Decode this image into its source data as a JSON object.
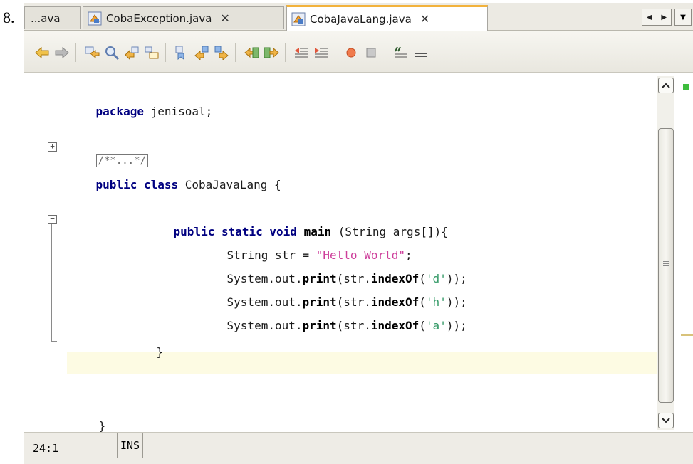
{
  "question_number": "8.",
  "tabs": [
    {
      "label": "...ava",
      "active": false
    },
    {
      "label": "CobaException.java",
      "close": "✕",
      "active": false
    },
    {
      "label": "CobaJavaLang.java",
      "close": "✕",
      "active": true
    }
  ],
  "tab_nav": {
    "left": "◀",
    "right": "▶",
    "dropdown": "▼"
  },
  "toolbar_icons": [
    "back-icon",
    "forward-icon",
    "find-selection-icon",
    "find-previous-icon",
    "find-next-icon",
    "toggle-highlight-icon",
    "toggle-bookmark-icon",
    "previous-bookmark-icon",
    "next-bookmark-icon",
    "shift-left-icon",
    "shift-right-icon",
    "comment-icon",
    "uncomment-icon",
    "start-macro-icon",
    "stop-macro-icon",
    "format-icon",
    "toggle-lines-icon"
  ],
  "code": {
    "package_kw": "package",
    "package_name": " jenisoal;",
    "folded_comment": "/**...*/",
    "class_kw": "public class",
    "class_rest": " CobaJavaLang {",
    "method_kw": "public static void",
    "method_name": "main",
    "method_rest": " (String args[]){",
    "line_str_a": "String str = ",
    "line_str_lit": "\"Hello World\"",
    "line_str_end": ";",
    "print_prefix": "System.out.",
    "print_kw": "print",
    "print_open": "(str.",
    "indexof_kw": "indexOf",
    "print_lines": [
      {
        "char": "'d'"
      },
      {
        "char": "'h'"
      },
      {
        "char": "'a'"
      }
    ],
    "print_close": "(",
    "print_tail": "));",
    "method_close": "}",
    "class_close": "}"
  },
  "status": {
    "position": "24:1",
    "mode": "INS"
  },
  "colors": {
    "keyword": "#000080",
    "string": "#ce3f9b",
    "char": "#339966",
    "current_line": "#fdfbe3"
  }
}
